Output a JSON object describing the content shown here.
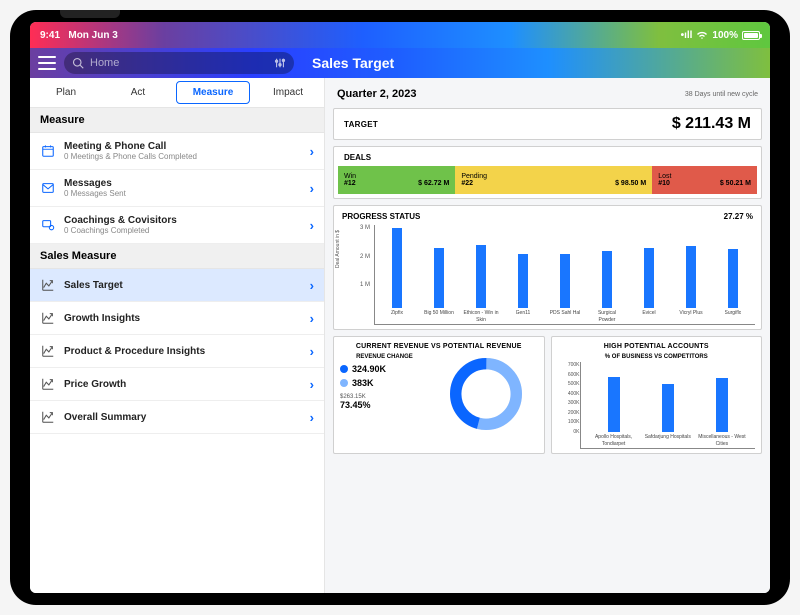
{
  "status": {
    "time": "9:41",
    "date": "Mon Jun 3",
    "signal": "•ıll",
    "wifi": "⌇",
    "battery": "100%"
  },
  "header": {
    "search_placeholder": "Home",
    "title": "Sales Target"
  },
  "tabs": [
    "Plan",
    "Act",
    "Measure",
    "Impact"
  ],
  "active_tab": 2,
  "sections": [
    {
      "header": "Measure",
      "items": [
        {
          "icon": "calendar",
          "title": "Meeting & Phone Call",
          "sub": "0 Meetings & Phone Calls Completed"
        },
        {
          "icon": "mail",
          "title": "Messages",
          "sub": "0 Messages Sent"
        },
        {
          "icon": "coach",
          "title": "Coachings & Covisitors",
          "sub": "0 Coachings Completed"
        }
      ]
    },
    {
      "header": "Sales Measure",
      "items": [
        {
          "icon": "chart",
          "title": "Sales Target",
          "selected": true
        },
        {
          "icon": "chart",
          "title": "Growth Insights"
        },
        {
          "icon": "chart",
          "title": "Product & Procedure Insights"
        },
        {
          "icon": "chart",
          "title": "Price Growth"
        },
        {
          "icon": "chart",
          "title": "Overall Summary"
        }
      ]
    }
  ],
  "quarter": {
    "label": "Quarter 2, 2023",
    "sub": "38 Days until new cycle"
  },
  "target": {
    "label": "TARGET",
    "value": "$ 211.43 M"
  },
  "deals": {
    "label": "DEALS",
    "segments": [
      {
        "name": "Win",
        "count": "#12",
        "value": "$ 62.72 M"
      },
      {
        "name": "Pending",
        "count": "#22",
        "value": "$ 98.50 M"
      },
      {
        "name": "Lost",
        "count": "#10",
        "value": "$ 50.21 M"
      }
    ]
  },
  "progress": {
    "label": "PROGRESS STATUS",
    "pct": "27.27 %",
    "ylabel": "Deal Amount in $",
    "yticks": [
      "3 M",
      "2 M",
      "1 M"
    ]
  },
  "revenue": {
    "title": "CURRENT REVENUE VS POTENTIAL REVENUE",
    "sub": "REVENUE CHANGE",
    "v1": "324.90K",
    "v2": "383K",
    "foot": "$263.15K",
    "pct": "73.45%",
    "colors": {
      "c1": "#0a66ff",
      "c2": "#7fb5ff"
    }
  },
  "accounts": {
    "title": "HIGH POTENTIAL ACCOUNTS",
    "sub": "% OF BUSINESS VS COMPETITORS",
    "yticks": [
      "700K",
      "600K",
      "500K",
      "400K",
      "300K",
      "200K",
      "100K",
      "0K"
    ]
  },
  "chart_data": [
    {
      "type": "bar",
      "title": "Progress Status",
      "ylabel": "Deal Amount in $",
      "ylim": [
        0,
        3000000
      ],
      "categories": [
        "Zipfix",
        "Big 50 Million",
        "Ethicon - Win in Skin",
        "Gen11",
        "PDS Sahl Hal",
        "Surgical Powder",
        "Evicel",
        "Vicryl Plus",
        "Surgiflo"
      ],
      "values": [
        2800000,
        2100000,
        2200000,
        1900000,
        1900000,
        2000000,
        2100000,
        2150000,
        2050000
      ]
    },
    {
      "type": "pie",
      "title": "Current Revenue vs Potential Revenue",
      "series": [
        {
          "name": "324.90K",
          "value": 324900,
          "color": "#0a66ff"
        },
        {
          "name": "383K",
          "value": 383000,
          "color": "#7fb5ff"
        }
      ],
      "annotation": {
        "change": "$263.15K",
        "pct": 73.45
      }
    },
    {
      "type": "bar",
      "title": "High Potential Accounts",
      "sub": "% of Business vs Competitors",
      "ylim": [
        0,
        700000
      ],
      "categories": [
        "Apollo Hospitals, Tondiarpet",
        "Safdarjung Hospitals",
        "Miscellaneous - West Cities"
      ],
      "values": [
        550000,
        480000,
        540000
      ]
    }
  ]
}
